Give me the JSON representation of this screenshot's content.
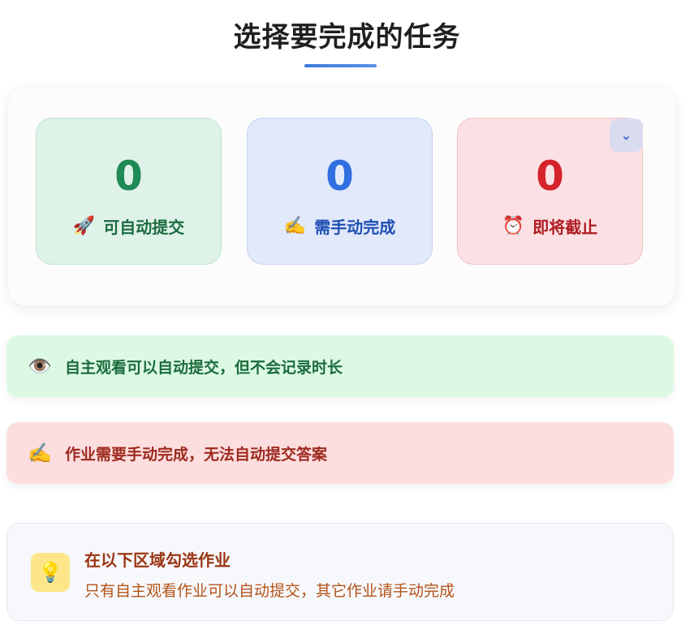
{
  "header": {
    "title": "选择要完成的任务"
  },
  "stats": [
    {
      "count": "0",
      "emoji": "🚀",
      "label": "可自动提交"
    },
    {
      "count": "0",
      "emoji": "✍️",
      "label": "需手动完成"
    },
    {
      "count": "0",
      "emoji": "⏰",
      "label": "即将截止"
    }
  ],
  "collapse_icon": "⌄",
  "notices": [
    {
      "emoji": "👁️",
      "text": "自主观看可以自动提交，但不会记录时长"
    },
    {
      "emoji": "✍️",
      "text": "作业需要手动完成，无法自动提交答案"
    }
  ],
  "hint": {
    "emoji": "💡",
    "title": "在以下区域勾选作业",
    "body": "只有自主观看作业可以自动提交，其它作业请手动完成"
  },
  "colors": {
    "accent": "#3b7bdc",
    "auto_green": "#1f8a55",
    "manual_blue": "#2f6fe0",
    "deadline_red": "#d6222b"
  }
}
